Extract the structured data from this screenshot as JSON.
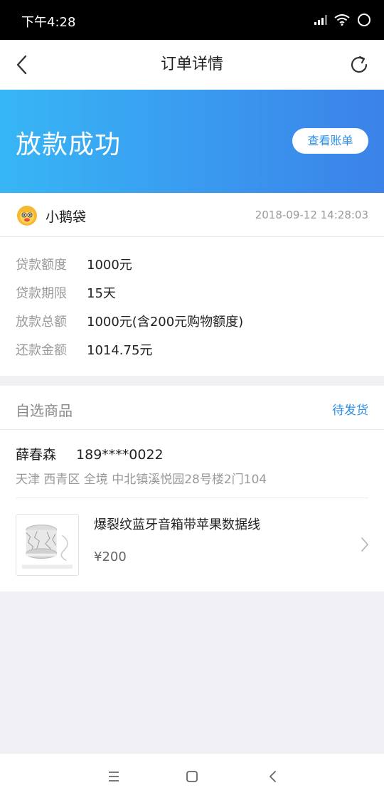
{
  "status_bar": {
    "time": "下午4:28"
  },
  "nav": {
    "title": "订单详情"
  },
  "banner": {
    "title": "放款成功",
    "button_label": "查看账单"
  },
  "lender": {
    "name": "小鹅袋",
    "timestamp": "2018-09-12 14:28:03"
  },
  "loan_info": [
    {
      "label": "贷款额度",
      "value": "1000元"
    },
    {
      "label": "贷款期限",
      "value": "15天"
    },
    {
      "label": "放款总额",
      "value": "1000元(含200元购物额度)"
    },
    {
      "label": "还款金额",
      "value": "1014.75元"
    }
  ],
  "goods": {
    "title": "自选商品",
    "status": "待发货",
    "recipient_name": "薛春森",
    "recipient_phone": "189****0022",
    "address": "天津 西青区 全境 中北镇溪悦园28号楼2门104",
    "product_name": "爆裂纹蓝牙音箱带苹果数据线",
    "product_price": "¥200"
  },
  "colors": {
    "accent": "#2f8fe8",
    "banner_start": "#37b6f5",
    "banner_end": "#3b82e8"
  },
  "icons": [
    "back-arrow-icon",
    "refresh-icon",
    "chevron-right-icon",
    "menu-icon",
    "home-icon",
    "back-nav-icon"
  ]
}
